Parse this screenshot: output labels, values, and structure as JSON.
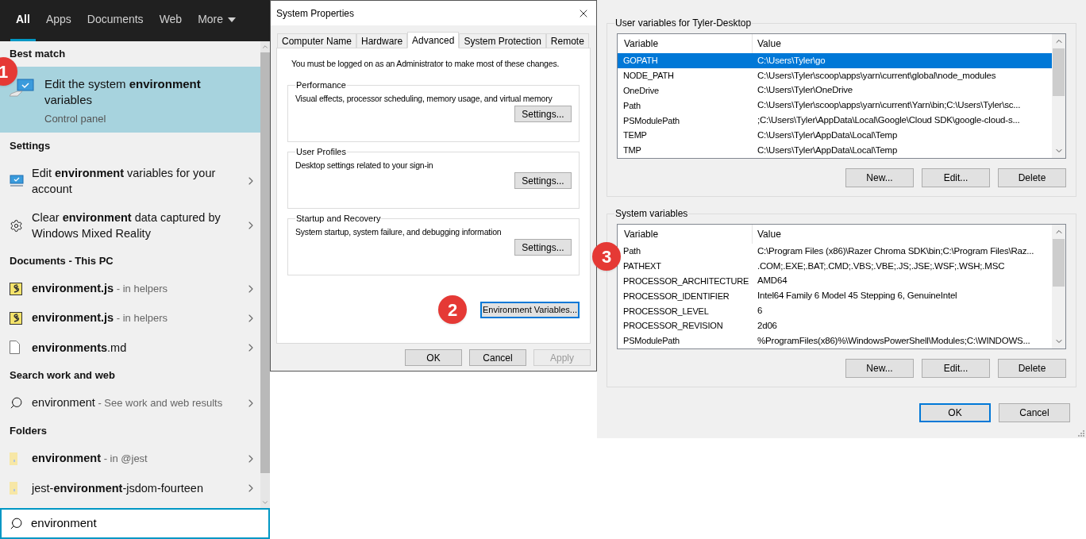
{
  "search_panel": {
    "tabs": [
      {
        "label": "All",
        "selected": true
      },
      {
        "label": "Apps",
        "selected": false
      },
      {
        "label": "Documents",
        "selected": false
      },
      {
        "label": "Web",
        "selected": false
      },
      {
        "label": "More",
        "selected": false,
        "dropdown": true
      }
    ],
    "best_match": {
      "header": "Best match",
      "title": "Edit the system **environment** variables",
      "subtitle": "Control panel",
      "selected": true
    },
    "sections": [
      {
        "header": "Settings",
        "items": [
          {
            "kind": "display-setting",
            "text": "Edit **environment** variables for your account"
          },
          {
            "kind": "app-setting",
            "text": "Clear **environment** data captured by Windows Mixed Reality"
          }
        ]
      },
      {
        "header": "Documents - This PC",
        "items": [
          {
            "kind": "script",
            "text": "**environment.js**",
            "detail": " - in helpers"
          },
          {
            "kind": "script",
            "text": "**environment.js**",
            "detail": " - in helpers"
          },
          {
            "kind": "document",
            "text": "**environments**.md"
          }
        ]
      },
      {
        "header": "Search work and web",
        "items": [
          {
            "kind": "web-search",
            "text": "environment",
            "detail": " - See work and web results"
          }
        ]
      },
      {
        "header": "Folders",
        "items": [
          {
            "kind": "folder",
            "text": "**environment**",
            "detail": " - in @jest"
          },
          {
            "kind": "folder",
            "text": "jest-**environment**-jsdom-fourteen"
          }
        ]
      }
    ],
    "search_box": {
      "value": "environment"
    }
  },
  "system_properties": {
    "title": "System Properties",
    "tabs": [
      {
        "label": "Computer Name",
        "selected": false
      },
      {
        "label": "Hardware",
        "selected": false
      },
      {
        "label": "Advanced",
        "selected": true
      },
      {
        "label": "System Protection",
        "selected": false
      },
      {
        "label": "Remote",
        "selected": false
      }
    ],
    "notice": "You must be logged on as an Administrator to make most of these changes.",
    "groups": [
      {
        "title": "Performance",
        "description": "Visual effects, processor scheduling, memory usage, and virtual memory",
        "button": "Settings..."
      },
      {
        "title": "User Profiles",
        "description": "Desktop settings related to your sign-in",
        "button": "Settings..."
      },
      {
        "title": "Startup and Recovery",
        "description": "System startup, system failure, and debugging information",
        "button": "Settings..."
      }
    ],
    "env_button": {
      "label": "Environment Variables...",
      "focused": true
    },
    "buttons": [
      {
        "label": "OK",
        "disabled": false
      },
      {
        "label": "Cancel",
        "disabled": false
      },
      {
        "label": "Apply",
        "disabled": true
      }
    ]
  },
  "environment_variables": {
    "user": {
      "title": "User variables for Tyler-Desktop",
      "columns": [
        "Variable",
        "Value"
      ],
      "rows": [
        {
          "variable": "GOPATH",
          "value": "C:\\Users\\Tyler\\go",
          "selected": true
        },
        {
          "variable": "NODE_PATH",
          "value": "C:\\Users\\Tyler\\scoop\\apps\\yarn\\current\\global\\node_modules",
          "selected": false
        },
        {
          "variable": "OneDrive",
          "value": "C:\\Users\\Tyler\\OneDrive",
          "selected": false
        },
        {
          "variable": "Path",
          "value": "C:\\Users\\Tyler\\scoop\\apps\\yarn\\current\\Yarn\\bin;C:\\Users\\Tyler\\sc...",
          "selected": false
        },
        {
          "variable": "PSModulePath",
          "value": ";C:\\Users\\Tyler\\AppData\\Local\\Google\\Cloud SDK\\google-cloud-s...",
          "selected": false
        },
        {
          "variable": "TEMP",
          "value": "C:\\Users\\Tyler\\AppData\\Local\\Temp",
          "selected": false
        },
        {
          "variable": "TMP",
          "value": "C:\\Users\\Tyler\\AppData\\Local\\Temp",
          "selected": false
        }
      ],
      "buttons": [
        "New...",
        "Edit...",
        "Delete"
      ]
    },
    "system": {
      "title": "System variables",
      "columns": [
        "Variable",
        "Value"
      ],
      "rows": [
        {
          "variable": "Path",
          "value": "C:\\Program Files (x86)\\Razer Chroma SDK\\bin;C:\\Program Files\\Raz...",
          "selected": false
        },
        {
          "variable": "PATHEXT",
          "value": ".COM;.EXE;.BAT;.CMD;.VBS;.VBE;.JS;.JSE;.WSF;.WSH;.MSC",
          "selected": false
        },
        {
          "variable": "PROCESSOR_ARCHITECTURE",
          "value": "AMD64",
          "selected": false
        },
        {
          "variable": "PROCESSOR_IDENTIFIER",
          "value": "Intel64 Family 6 Model 45 Stepping 6, GenuineIntel",
          "selected": false
        },
        {
          "variable": "PROCESSOR_LEVEL",
          "value": "6",
          "selected": false
        },
        {
          "variable": "PROCESSOR_REVISION",
          "value": "2d06",
          "selected": false
        },
        {
          "variable": "PSModulePath",
          "value": "%ProgramFiles(x86)%\\WindowsPowerShell\\Modules;C:\\WINDOWS...",
          "selected": false
        }
      ],
      "buttons": [
        "New...",
        "Edit...",
        "Delete"
      ]
    },
    "buttons": [
      {
        "label": "OK",
        "default": true
      },
      {
        "label": "Cancel",
        "default": false
      }
    ]
  },
  "step_badges": [
    "1",
    "2",
    "3"
  ]
}
